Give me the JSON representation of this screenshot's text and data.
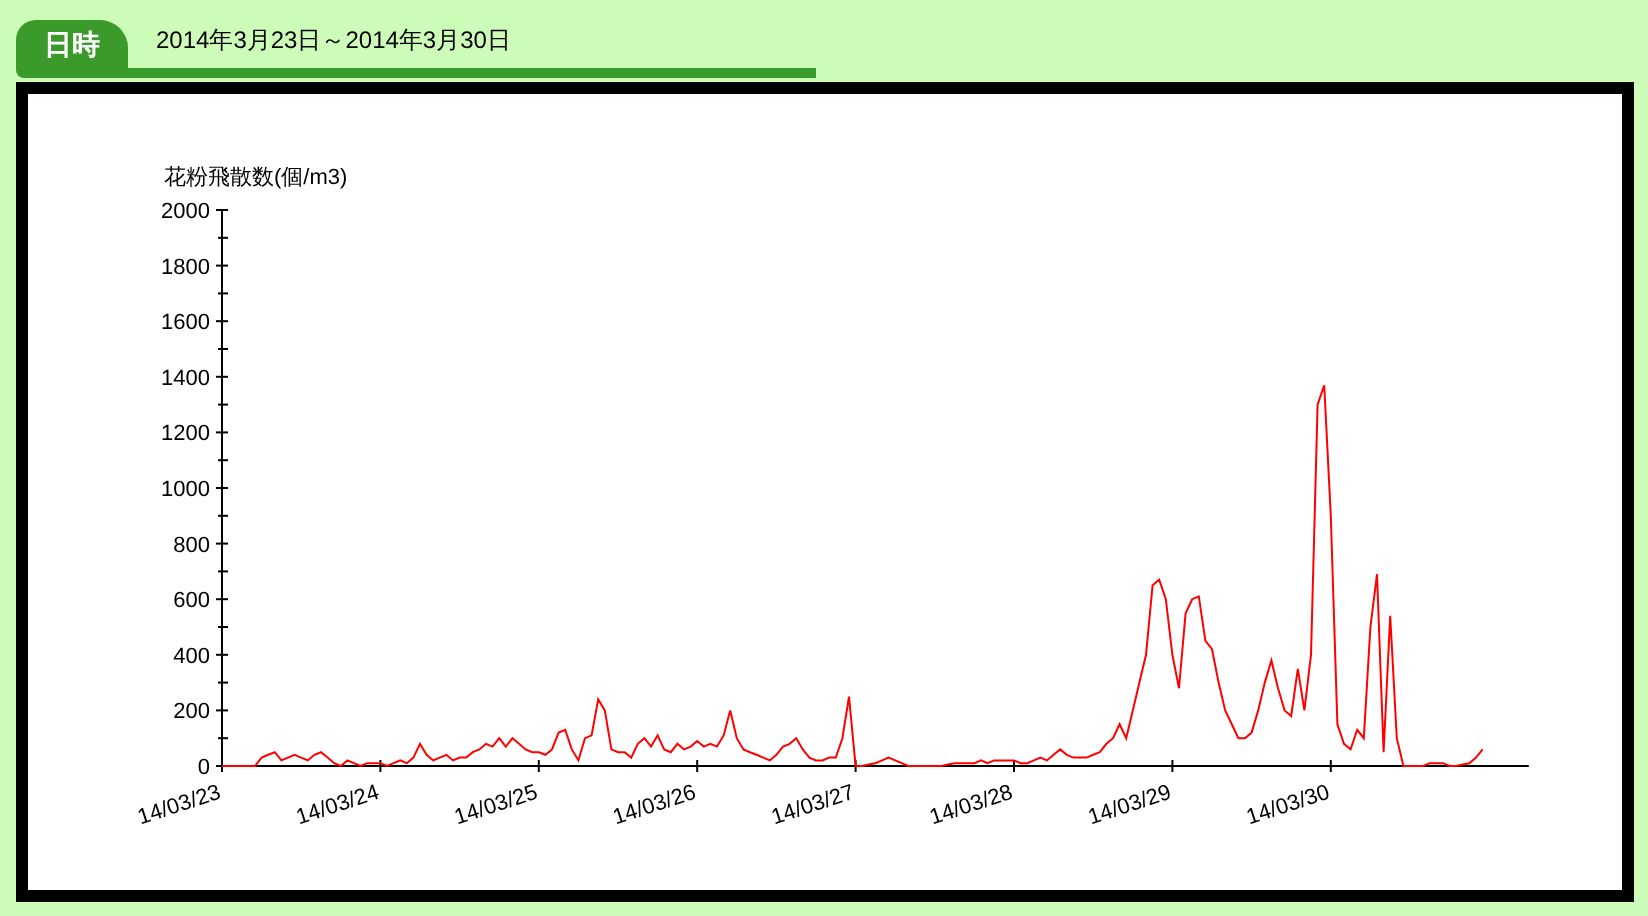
{
  "header": {
    "label": "日時",
    "date_range": "2014年3月23日～2014年3月30日"
  },
  "chart": {
    "chart_data": {
      "type": "line",
      "ylabel": "花粉飛散数(個/m3)",
      "ylim": [
        0,
        2000
      ],
      "yticks": [
        0,
        200,
        400,
        600,
        800,
        1000,
        1200,
        1400,
        1600,
        1800,
        2000
      ],
      "categories": [
        "14/03/23",
        null,
        null,
        null,
        null,
        null,
        null,
        null,
        null,
        null,
        null,
        null,
        null,
        null,
        null,
        null,
        null,
        null,
        null,
        null,
        null,
        null,
        null,
        null,
        "14/03/24",
        null,
        null,
        null,
        null,
        null,
        null,
        null,
        null,
        null,
        null,
        null,
        null,
        null,
        null,
        null,
        null,
        null,
        null,
        null,
        null,
        null,
        null,
        null,
        "14/03/25",
        null,
        null,
        null,
        null,
        null,
        null,
        null,
        null,
        null,
        null,
        null,
        null,
        null,
        null,
        null,
        null,
        null,
        null,
        null,
        null,
        null,
        null,
        null,
        "14/03/26",
        null,
        null,
        null,
        null,
        null,
        null,
        null,
        null,
        null,
        null,
        null,
        null,
        null,
        null,
        null,
        null,
        null,
        null,
        null,
        null,
        null,
        null,
        null,
        "14/03/27",
        null,
        null,
        null,
        null,
        null,
        null,
        null,
        null,
        null,
        null,
        null,
        null,
        null,
        null,
        null,
        null,
        null,
        null,
        null,
        null,
        null,
        null,
        null,
        "14/03/28",
        null,
        null,
        null,
        null,
        null,
        null,
        null,
        null,
        null,
        null,
        null,
        null,
        null,
        null,
        null,
        null,
        null,
        null,
        null,
        null,
        null,
        null,
        null,
        "14/03/29",
        null,
        null,
        null,
        null,
        null,
        null,
        null,
        null,
        null,
        null,
        null,
        null,
        null,
        null,
        null,
        null,
        null,
        null,
        null,
        null,
        null,
        null,
        null,
        "14/03/30",
        null,
        null,
        null,
        null,
        null,
        null,
        null,
        null,
        null,
        null,
        null,
        null,
        null,
        null,
        null,
        null,
        null,
        null,
        null,
        null,
        null,
        null,
        null
      ],
      "series": [
        {
          "color": "#ff0000",
          "values": [
            0,
            0,
            0,
            0,
            0,
            0,
            30,
            40,
            50,
            20,
            30,
            40,
            30,
            20,
            40,
            50,
            30,
            10,
            0,
            20,
            10,
            0,
            10,
            10,
            10,
            0,
            10,
            20,
            10,
            30,
            80,
            40,
            20,
            30,
            40,
            20,
            30,
            30,
            50,
            60,
            80,
            70,
            100,
            70,
            100,
            80,
            60,
            50,
            50,
            40,
            60,
            120,
            130,
            60,
            20,
            100,
            110,
            240,
            200,
            60,
            50,
            50,
            30,
            80,
            100,
            70,
            110,
            60,
            50,
            80,
            60,
            70,
            90,
            70,
            80,
            70,
            110,
            200,
            100,
            60,
            50,
            40,
            30,
            20,
            40,
            70,
            80,
            100,
            60,
            30,
            20,
            20,
            30,
            30,
            100,
            250,
            0,
            0,
            5,
            10,
            20,
            30,
            20,
            10,
            0,
            0,
            0,
            0,
            0,
            0,
            5,
            10,
            10,
            10,
            10,
            20,
            10,
            20,
            20,
            20,
            20,
            10,
            10,
            20,
            30,
            20,
            40,
            60,
            40,
            30,
            30,
            30,
            40,
            50,
            80,
            100,
            150,
            100,
            200,
            300,
            400,
            650,
            670,
            600,
            400,
            280,
            550,
            600,
            610,
            450,
            420,
            300,
            200,
            150,
            100,
            100,
            120,
            200,
            300,
            380,
            280,
            200,
            180,
            350,
            200,
            400,
            1300,
            1370,
            900,
            150,
            80,
            60,
            130,
            100,
            500,
            690,
            50,
            540,
            100,
            0,
            0,
            0,
            0,
            10,
            10,
            10,
            0,
            0,
            5,
            10,
            30,
            60
          ]
        }
      ]
    }
  }
}
